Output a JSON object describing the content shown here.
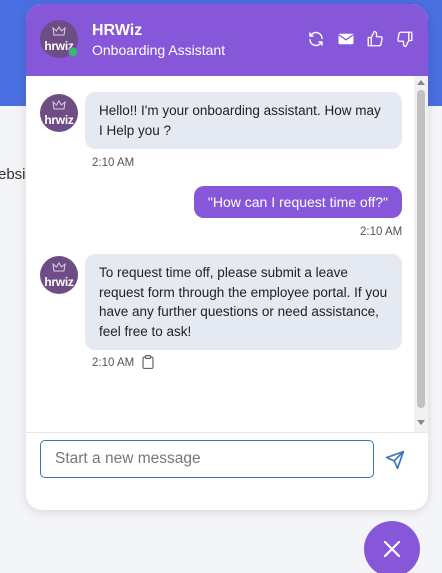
{
  "background": {
    "partial_text": "ebsi"
  },
  "header": {
    "title": "HRWiz",
    "subtitle": "Onboarding Assistant",
    "avatar_text": "hrwiz",
    "icons": [
      "refresh-icon",
      "mail-icon",
      "thumbs-up-icon",
      "thumbs-down-icon"
    ]
  },
  "messages": [
    {
      "sender": "bot",
      "avatar_text": "hrwiz",
      "text": "Hello!! I'm your onboarding assistant. How may I Help you ?",
      "time": "2:10 AM"
    },
    {
      "sender": "user",
      "text": "\"How can I request time off?\"",
      "time": "2:10 AM"
    },
    {
      "sender": "bot",
      "avatar_text": "hrwiz",
      "text": "To request time off, please submit a leave request form through the employee portal. If you have any further questions or need assistance, feel free to ask!",
      "time": "2:10 AM",
      "has_copy_icon": true
    }
  ],
  "composer": {
    "placeholder": "Start a new message",
    "value": ""
  },
  "colors": {
    "header": "#8757d9",
    "user_bubble": "#8757d9",
    "bot_bubble": "#e5e9f1",
    "online": "#33c05a",
    "input_border": "#3b74b9",
    "page_topbar": "#4a6fe0"
  }
}
